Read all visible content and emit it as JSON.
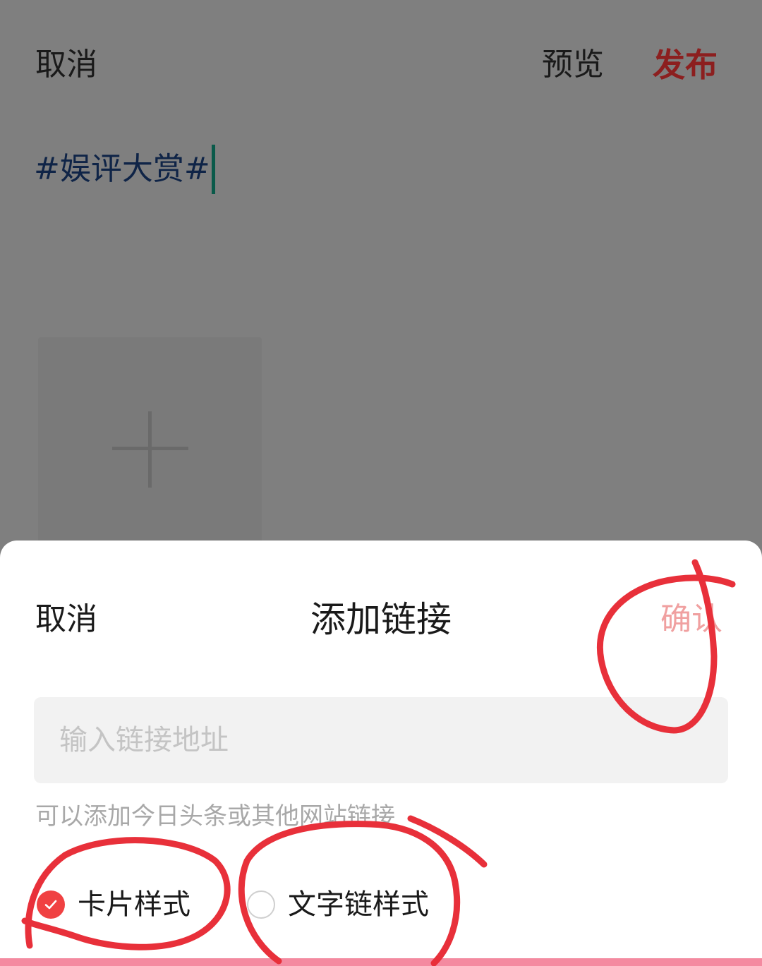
{
  "editor": {
    "cancel": "取消",
    "preview": "预览",
    "publish": "发布",
    "content": "#娱评大赏#"
  },
  "sheet": {
    "cancel": "取消",
    "title": "添加链接",
    "confirm": "确认",
    "input_placeholder": "输入链接地址",
    "hint": "可以添加今日头条或其他网站链接",
    "options": [
      {
        "label": "卡片样式",
        "selected": true
      },
      {
        "label": "文字链样式",
        "selected": false
      }
    ]
  },
  "colors": {
    "publish": "#8c1f1f",
    "accent": "#f04142",
    "confirm_disabled": "#f0a0a0",
    "annotation": "#e8303a"
  },
  "icons": {
    "add_image": "plus-icon",
    "check": "check-icon"
  }
}
